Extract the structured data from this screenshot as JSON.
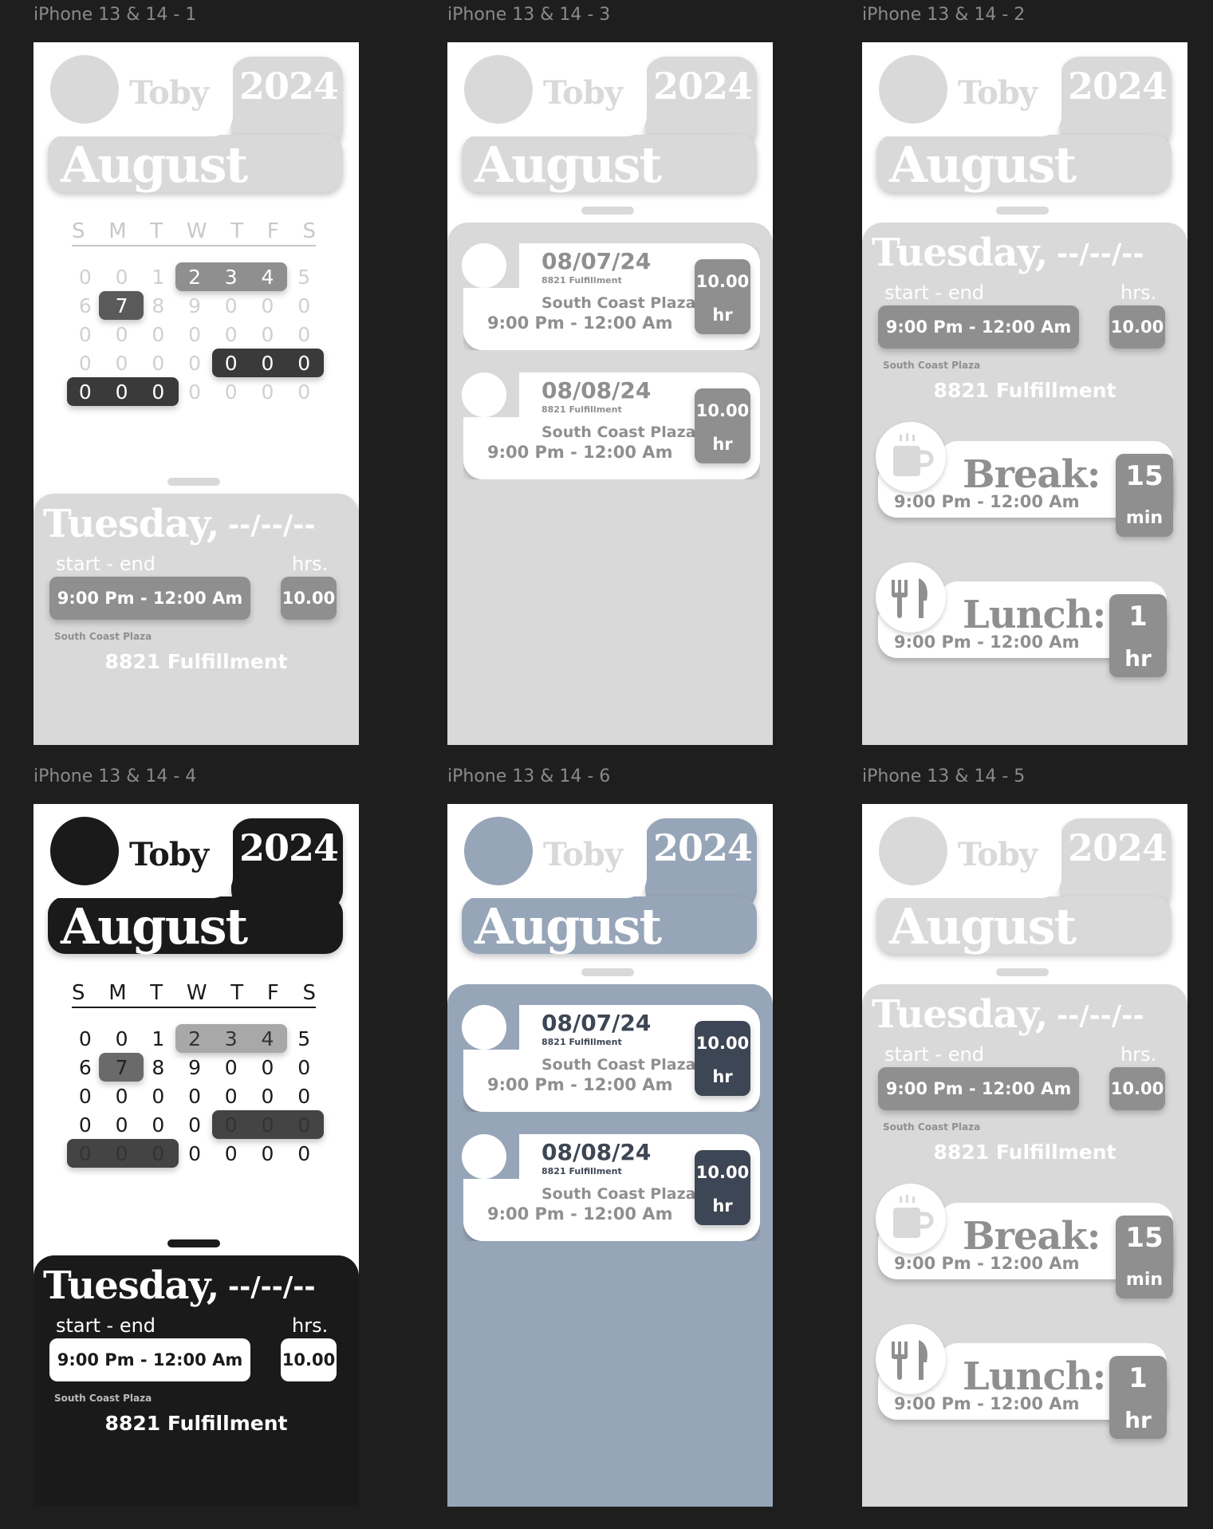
{
  "frames": {
    "f1": {
      "label": "iPhone 13 & 14 - 1"
    },
    "f3": {
      "label": "iPhone 13 & 14 - 3"
    },
    "f2": {
      "label": "iPhone 13 & 14 - 2"
    },
    "f4": {
      "label": "iPhone 13 & 14 - 4"
    },
    "f6": {
      "label": "iPhone 13 & 14 - 6"
    },
    "f5": {
      "label": "iPhone 13 & 14 - 5"
    }
  },
  "header": {
    "name": "Toby",
    "year": "2024",
    "month": "August"
  },
  "calendar": {
    "weekdays": [
      "S",
      "M",
      "T",
      "W",
      "T",
      "F",
      "S"
    ],
    "rows": [
      [
        "0",
        "0",
        "1",
        "2",
        "3",
        "4",
        "5"
      ],
      [
        "6",
        "7",
        "8",
        "9",
        "0",
        "0",
        "0"
      ],
      [
        "0",
        "0",
        "0",
        "0",
        "0",
        "0",
        "0"
      ],
      [
        "0",
        "0",
        "0",
        "0",
        "0",
        "0",
        "0"
      ],
      [
        "0",
        "0",
        "0",
        "0",
        "0",
        "0",
        "0"
      ]
    ]
  },
  "day": {
    "title": "Tuesday,",
    "date": "--/--/--",
    "start_end_label": "start - end",
    "hrs_label": "hrs.",
    "time": "9:00 Pm - 12:00 Am",
    "hours": "10.00",
    "location_small": "South Coast Plaza",
    "location_big": "8821 Fulfillment"
  },
  "shifts": [
    {
      "date": "08/07/24",
      "sub": "8821 Fulfillment",
      "plaza": "South Coast Plaza",
      "time": "9:00 Pm - 12:00 Am",
      "hours": "10.00",
      "unit": "hr"
    },
    {
      "date": "08/08/24",
      "sub": "8821 Fulfillment",
      "plaza": "South Coast Plaza",
      "time": "9:00 Pm - 12:00 Am",
      "hours": "10.00",
      "unit": "hr"
    }
  ],
  "break": {
    "title": "Break:",
    "time": "9:00 Pm - 12:00 Am",
    "value": "15",
    "unit": "min",
    "icon": "coffee-mug-icon"
  },
  "lunch": {
    "title": "Lunch:",
    "time": "9:00 Pm - 12:00 Am",
    "value": "1",
    "unit": "hr",
    "icon": "fork-knife-icon"
  },
  "colors": {
    "canvas": "#1e1e1e",
    "light_gray": "#d9d9d9",
    "mid_gray": "#8f8f8f",
    "black": "#1a1a1a",
    "slate": "#97a5b8",
    "slate_dark": "#3d4654"
  }
}
